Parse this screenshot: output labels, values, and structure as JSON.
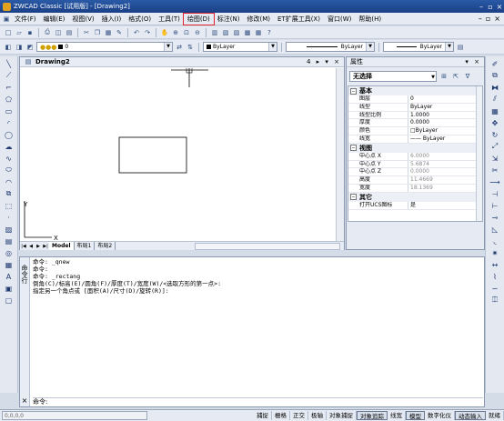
{
  "titlebar": {
    "title": "ZWCAD Classic [试用版] - [Drawing2]",
    "min": "–",
    "max": "▫",
    "close": "×"
  },
  "menubar": {
    "items": [
      "文件(F)",
      "编辑(E)",
      "视图(V)",
      "插入(I)",
      "格式(O)",
      "工具(T)",
      "绘图(D)",
      "标注(N)",
      "修改(M)",
      "ET扩展工具(X)",
      "窗口(W)",
      "帮助(H)"
    ],
    "selected_index": 6,
    "right_controls": [
      "–",
      "▫",
      "×"
    ]
  },
  "layer_toolbar": {
    "layer_value": "0",
    "color_value": "ByLayer",
    "linetype_value": "ByLayer",
    "lineweight_value": "ByLayer"
  },
  "drawing": {
    "title": "Drawing2",
    "controls": "4 ▸ ▾ ×",
    "axis_x": "X",
    "axis_y": "Y",
    "tabs": [
      "Model",
      "布局1",
      "布局2"
    ],
    "active_tab": 0
  },
  "properties": {
    "title": "属性",
    "controls": "▾ ×",
    "selection": "无选择",
    "categories": [
      {
        "name": "基本",
        "rows": [
          {
            "name": "图层",
            "value": "0",
            "gray": false
          },
          {
            "name": "线型",
            "value": "ByLayer",
            "gray": false
          },
          {
            "name": "线型比例",
            "value": "1.0000",
            "gray": false
          },
          {
            "name": "厚度",
            "value": "0.0000",
            "gray": false
          },
          {
            "name": "颜色",
            "value": "□ByLayer",
            "gray": false
          },
          {
            "name": "线宽",
            "value": "—— ByLayer",
            "gray": false
          }
        ]
      },
      {
        "name": "视图",
        "rows": [
          {
            "name": "中心点 X",
            "value": "6.0000",
            "gray": true
          },
          {
            "name": "中心点 Y",
            "value": "5.6874",
            "gray": true
          },
          {
            "name": "中心点 Z",
            "value": "0.0000",
            "gray": true
          },
          {
            "name": "高度",
            "value": "11.4669",
            "gray": true
          },
          {
            "name": "宽度",
            "value": "18.1369",
            "gray": true
          }
        ]
      },
      {
        "name": "其它",
        "rows": [
          {
            "name": "打开UCS图标",
            "value": "是",
            "gray": false
          }
        ]
      }
    ]
  },
  "command": {
    "side_label": "命令行",
    "history": "命令: _qnew\n命令:\n命令: _rectang\n倒角(C)/标高(E)/圆角(F)/厚度(T)/宽度(W)/<选取方形的第一点>:\n指定另一个角点或 [面积(A)/尺寸(D)/旋转(R)]:",
    "prompt": "命令:",
    "close": "×"
  },
  "statusbar": {
    "coords": "0,0,0,0",
    "buttons": [
      "捕捉",
      "栅格",
      "正交",
      "极轴",
      "对象捕捉",
      "对象追踪",
      "线宽",
      "模型",
      "数字化仪",
      "动态输入",
      "就绪"
    ],
    "on_indexes": [
      5,
      7,
      9
    ]
  }
}
